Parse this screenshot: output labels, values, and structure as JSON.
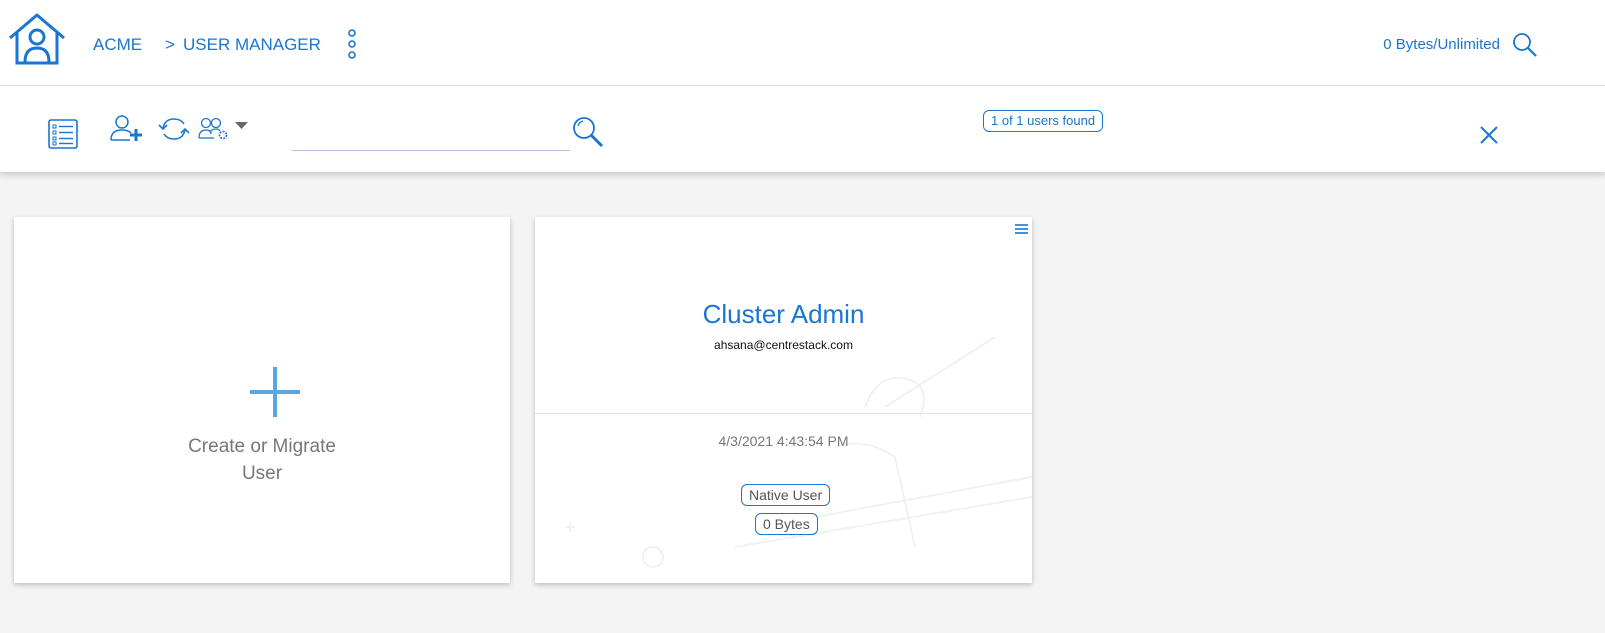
{
  "header": {
    "breadcrumb_root": "ACME",
    "breadcrumb_separator": ">",
    "breadcrumb_current": "USER MANAGER",
    "storage_usage": "0 Bytes/Unlimited"
  },
  "toolbar": {
    "search_placeholder": "",
    "search_value": "",
    "results_badge": "1 of 1 users found"
  },
  "create_card": {
    "label_line1": "Create or Migrate",
    "label_line2": "User"
  },
  "users": [
    {
      "name": "Cluster Admin",
      "email": "ahsana@centrestack.com",
      "timestamp": "4/3/2021 4:43:54 PM",
      "type": "Native User",
      "storage": "0 Bytes"
    }
  ],
  "icons": {
    "home": "home-user-icon",
    "kebab": "more-vertical-icon",
    "top_search": "search-icon",
    "list_view": "list-view-icon",
    "add_user": "add-user-icon",
    "sync": "sync-icon",
    "user_settings": "user-group-settings-icon",
    "dropdown": "caret-down-icon",
    "toolbar_search": "search-icon",
    "close": "close-icon",
    "card_menu": "hamburger-menu-icon",
    "plus": "plus-icon"
  },
  "colors": {
    "accent": "#1976d2",
    "background": "#f4f4f4",
    "text_muted": "#777777"
  }
}
